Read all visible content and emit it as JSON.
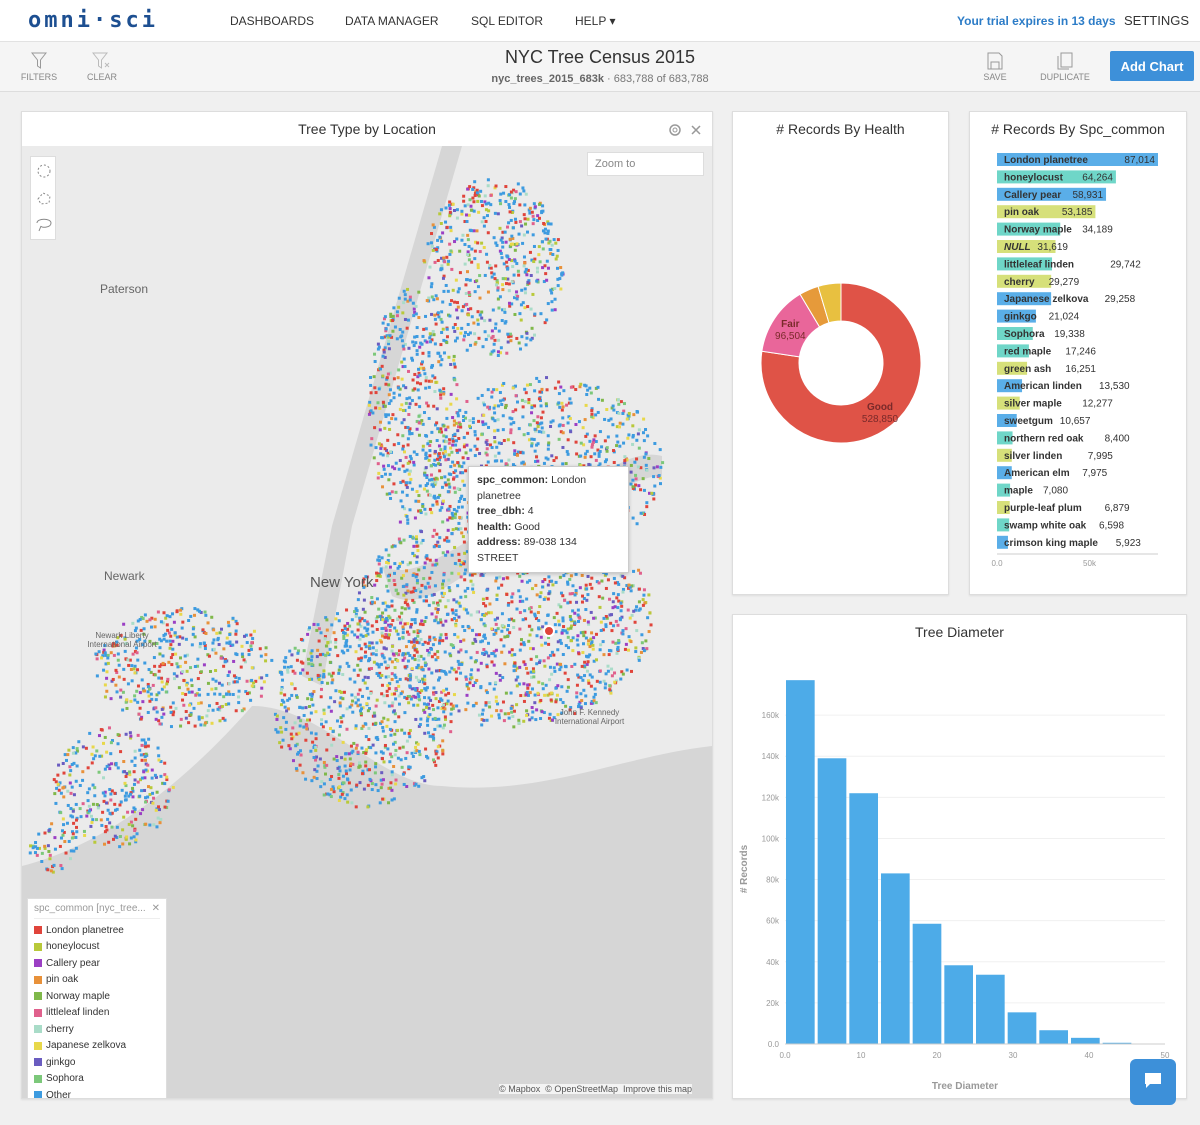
{
  "nav": {
    "logo": "omni·sci",
    "items": [
      "DASHBOARDS",
      "DATA MANAGER",
      "SQL EDITOR",
      "HELP ▾"
    ],
    "trial": "Your trial expires in 13 days",
    "settings": "SETTINGS"
  },
  "toolbar": {
    "filters": "FILTERS",
    "clear": "CLEAR",
    "save": "SAVE",
    "duplicate": "DUPLICATE",
    "add_chart": "Add Chart"
  },
  "dashboard": {
    "title": "NYC Tree Census 2015",
    "table": "nyc_trees_2015_683k",
    "count": "· 683,788 of 683,788"
  },
  "map": {
    "title": "Tree Type by Location",
    "zoom_placeholder": "Zoom to",
    "labels": [
      "Paterson",
      "Newark",
      "New York",
      "Newark Liberty International Airport",
      "John F. Kennedy International Airport"
    ],
    "tooltip": [
      {
        "k": "spc_common:",
        "v": "London planetree"
      },
      {
        "k": "tree_dbh:",
        "v": "4"
      },
      {
        "k": "health:",
        "v": "Good"
      },
      {
        "k": "address:",
        "v": "89-038 134 STREET"
      }
    ],
    "attribution": [
      "© Mapbox",
      "© OpenStreetMap",
      "Improve this map"
    ],
    "legend": {
      "title": "spc_common [nyc_tree...",
      "items": [
        {
          "label": "London planetree",
          "color": "#e0443b"
        },
        {
          "label": "honeylocust",
          "color": "#b8c93a"
        },
        {
          "label": "Callery pear",
          "color": "#9b3fc4"
        },
        {
          "label": "pin oak",
          "color": "#e8913a"
        },
        {
          "label": "Norway maple",
          "color": "#7fb84a"
        },
        {
          "label": "littleleaf linden",
          "color": "#e0608c"
        },
        {
          "label": "cherry",
          "color": "#a9dcc8"
        },
        {
          "label": "Japanese zelkova",
          "color": "#e8d84a"
        },
        {
          "label": "ginkgo",
          "color": "#6a5cc0"
        },
        {
          "label": "Sophora",
          "color": "#7cc87a"
        },
        {
          "label": "Other",
          "color": "#3d9be0"
        }
      ]
    }
  },
  "health": {
    "title": "# Records By Health",
    "chart_data": {
      "type": "pie",
      "slices": [
        {
          "label": "Good",
          "value": 528850,
          "color": "#df5347"
        },
        {
          "label": "Fair",
          "value": 96504,
          "color": "#e9669a"
        },
        {
          "label": "",
          "value": 26818,
          "color": "#e69a3a"
        },
        {
          "label": "",
          "value": 31616,
          "color": "#e8c040"
        }
      ]
    }
  },
  "species": {
    "title": "# Records By Spc_common",
    "chart_data": {
      "type": "bar",
      "orientation": "horizontal",
      "xlim": [
        0,
        87014
      ],
      "ticks": [
        "0.0",
        "50k"
      ],
      "categories": [
        "London planetree",
        "honeylocust",
        "Callery pear",
        "pin oak",
        "Norway maple",
        "NULL",
        "littleleaf linden",
        "cherry",
        "Japanese zelkova",
        "ginkgo",
        "Sophora",
        "red maple",
        "green ash",
        "American linden",
        "silver maple",
        "sweetgum",
        "northern red oak",
        "silver linden",
        "American elm",
        "maple",
        "purple-leaf plum",
        "swamp white oak",
        "crimson king maple"
      ],
      "values": [
        87014,
        64264,
        58931,
        53185,
        34189,
        31619,
        29742,
        29279,
        29258,
        21024,
        19338,
        17246,
        16251,
        13530,
        12277,
        10657,
        8400,
        7995,
        7975,
        7080,
        6879,
        6598,
        5923
      ],
      "labels": [
        "87,014",
        "64,264",
        "58,931",
        "53,185",
        "34,189",
        "31,619",
        "29,742",
        "29,279",
        "29,258",
        "21,024",
        "19,338",
        "17,246",
        "16,251",
        "13,530",
        "12,277",
        "10,657",
        "8,400",
        "7,995",
        "7,975",
        "7,080",
        "6,879",
        "6,598",
        "5,923"
      ],
      "colors": [
        "#5aaee8",
        "#6fd6c8",
        "#5aaee8",
        "#d6e07a",
        "#6fd6c8",
        "#d6e07a",
        "#6fd6c8",
        "#d6e07a",
        "#5aaee8",
        "#5aaee8",
        "#6fd6c8",
        "#6fd6c8",
        "#d6e07a",
        "#5aaee8",
        "#d6e07a",
        "#5aaee8",
        "#6fd6c8",
        "#d6e07a",
        "#5aaee8",
        "#6fd6c8",
        "#d6e07a",
        "#6fd6c8",
        "#5aaee8"
      ]
    }
  },
  "diameter": {
    "title": "Tree Diameter",
    "chart_data": {
      "type": "bar",
      "xlabel": "Tree Diameter",
      "ylabel": "# Records",
      "xlim": [
        0,
        50
      ],
      "ylim": [
        0,
        180000
      ],
      "xticks": [
        "0.0",
        "10",
        "20",
        "30",
        "40",
        "50"
      ],
      "yticks": [
        "0.0",
        "20k",
        "40k",
        "60k",
        "80k",
        "100k",
        "120k",
        "140k",
        "160k"
      ],
      "bin_width": 4.1667,
      "values": [
        177000,
        139000,
        122000,
        83000,
        58500,
        38300,
        33700,
        15400,
        6700,
        3000,
        600,
        100
      ],
      "color": "#4dabe8"
    }
  }
}
